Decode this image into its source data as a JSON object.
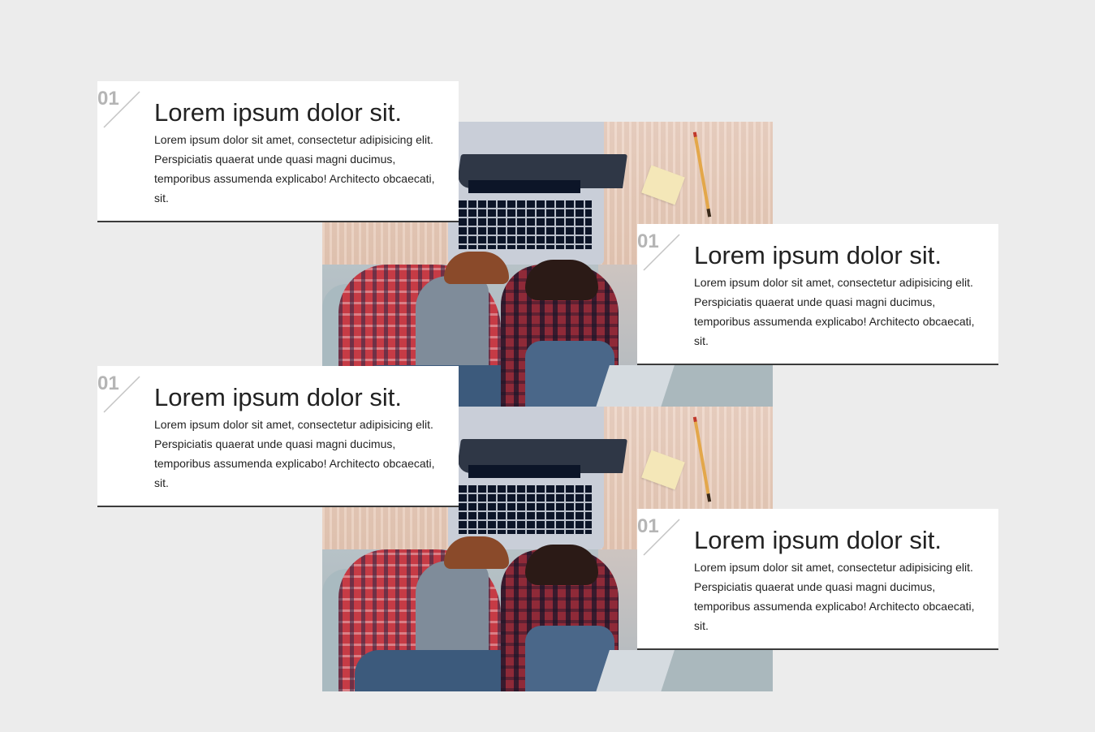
{
  "cards": [
    {
      "number": "01",
      "title": "Lorem ipsum dolor sit.",
      "body": "Lorem ipsum dolor sit amet, consectetur adipisicing elit. Perspiciatis quaerat unde quasi magni ducimus, temporibus assumenda explicabo! Architecto obcaecati, sit."
    },
    {
      "number": "01",
      "title": "Lorem ipsum dolor sit.",
      "body": "Lorem ipsum dolor sit amet, consectetur adipisicing elit. Perspiciatis quaerat unde quasi magni ducimus, temporibus assumenda explicabo! Architecto obcaecati, sit."
    },
    {
      "number": "01",
      "title": "Lorem ipsum dolor sit.",
      "body": "Lorem ipsum dolor sit amet, consectetur adipisicing elit. Perspiciatis quaerat unde quasi magni ducimus, temporibus assumenda explicabo! Architecto obcaecati, sit."
    },
    {
      "number": "01",
      "title": "Lorem ipsum dolor sit.",
      "body": "Lorem ipsum dolor sit amet, consectetur adipisicing elit. Perspiciatis quaerat unde quasi magni ducimus, temporibus assumenda explicabo! Architecto obcaecati, sit."
    }
  ],
  "colors": {
    "page_background": "#ececec",
    "card_background": "#ffffff",
    "card_border": "#3b3b3b",
    "number": "#b5b5b5",
    "text": "#222222"
  }
}
